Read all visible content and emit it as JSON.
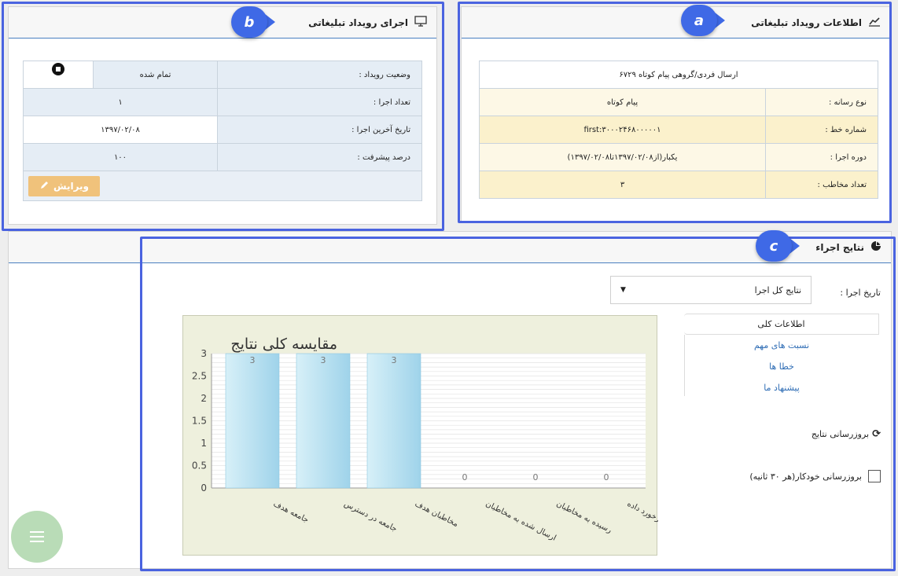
{
  "panel_a": {
    "title": "اطلاعات رویداد تبلیغاتی",
    "callout": "a",
    "header_row": "ارسال فردی/گروهی پیام کوتاه ۶۷۲۹",
    "rows": [
      {
        "label": "نوع رسانه :",
        "value": "پیام کوتاه"
      },
      {
        "label": "شماره خط :",
        "value": "first:۳۰۰۰۲۴۶۸۰۰۰۰۰۱"
      },
      {
        "label": "دوره اجرا :",
        "value": "یکبار(از۱۳۹۷/۰۲/۰۸تا۱۳۹۷/۰۲/۰۸)"
      },
      {
        "label": "تعداد مخاطب :",
        "value": "۳"
      }
    ]
  },
  "panel_b": {
    "title": "اجرای رویداد تبلیغاتی",
    "callout": "b",
    "rows": [
      {
        "label": "وضعیت رویداد :",
        "value": "تمام شده"
      },
      {
        "label": "تعداد اجرا :",
        "value": "۱"
      },
      {
        "label": "تاریخ آخرین اجرا :",
        "value": "۱۳۹۷/۰۲/۰۸"
      },
      {
        "label": "درصد پیشرفت :",
        "value": "۱۰۰"
      }
    ],
    "edit_button": "ویرایش"
  },
  "panel_c": {
    "title": "نتایج اجراء",
    "callout": "c",
    "date_label": "تاریخ اجرا :",
    "date_select": "نتایج کل اجرا",
    "tabs": [
      "اطلاعات کلی",
      "نسبت های مهم",
      "خطا ها",
      "پیشنهاد ما"
    ],
    "refresh_label": "بروزرسانی نتایج",
    "auto_refresh_label": "بروزرسانی خودکار(هر ۳۰ ثانیه)"
  },
  "colors": {
    "accent": "#3f69e6",
    "row_yellow": "#fbf1cc",
    "row_blue": "#e5edf5",
    "chart_bg": "#eef0dd",
    "bar": "#a8dbef"
  },
  "chart_data": {
    "type": "bar",
    "title": "مقایسه کلی نتایج",
    "categories": [
      "جامعه هدف",
      "جامعه در دسترس",
      "مخاطبان هدف",
      "ارسال شده به مخاطبان",
      "رسیده به مخاطبان",
      "مخاطبان بازخورد داده"
    ],
    "values": [
      3,
      3,
      3,
      0,
      0,
      0
    ],
    "yticks": [
      "0",
      "0.5",
      "1",
      "1.5",
      "2",
      "2.5",
      "3"
    ],
    "ylim": [
      0,
      3
    ],
    "grid": true
  }
}
